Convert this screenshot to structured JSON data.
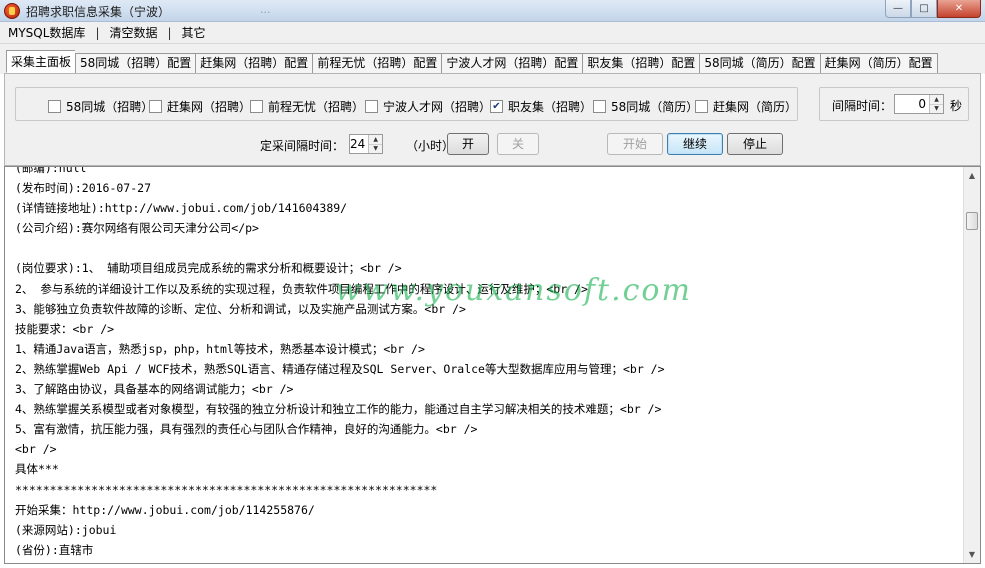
{
  "window": {
    "title": "招聘求职信息采集（宁波）",
    "title_ghost": "...",
    "controls": {
      "minimize": "—",
      "maximize": "□",
      "close": "✕"
    }
  },
  "menu": {
    "items": [
      "MYSQL数据库",
      "清空数据",
      "其它"
    ],
    "separator": "|"
  },
  "tabs": [
    "采集主面板",
    "58同城（招聘）配置",
    "赶集网（招聘）配置",
    "前程无忧（招聘）配置",
    "宁波人才网（招聘）配置",
    "职友集（招聘）配置",
    "58同城（简历）配置",
    "赶集网（简历）配置"
  ],
  "sources": [
    {
      "label": "58同城（招聘）",
      "checked": false
    },
    {
      "label": "赶集网（招聘）",
      "checked": false
    },
    {
      "label": "前程无忧（招聘）",
      "checked": false
    },
    {
      "label": "宁波人才网（招聘）",
      "checked": false
    },
    {
      "label": "职友集（招聘）",
      "checked": true
    },
    {
      "label": "58同城（简历）",
      "checked": false
    },
    {
      "label": "赶集网（简历）",
      "checked": false
    }
  ],
  "interval": {
    "label": "间隔时间：",
    "value": "0",
    "unit": "秒"
  },
  "schedule": {
    "label": "定采间隔时间：",
    "value": "24",
    "unit": "（小时）",
    "on_label": "开",
    "off_label": "关"
  },
  "actions": {
    "start": "开始",
    "continue": "继续",
    "stop": "停止"
  },
  "log": {
    "lines": [
      "(邮编):null",
      "(发布时间):2016-07-27",
      "(详情链接地址):http://www.jobui.com/job/141604389/",
      "(公司介绍):赛尔网络有限公司天津分公司</p>",
      "",
      "(岗位要求):1、 辅助项目组成员完成系统的需求分析和概要设计；<br />",
      "2、 参与系统的详细设计工作以及系统的实现过程，负责软件项目编程工作中的程序设计、运行及维护；<br />",
      "3、能够独立负责软件故障的诊断、定位、分析和调试，以及实施产品测试方案。<br />",
      "技能要求：<br />",
      "1、精通Java语言，熟悉jsp，php，html等技术，熟悉基本设计模式；<br />",
      "2、熟练掌握Web Api / WCF技术，熟悉SQL语言、精通存储过程及SQL Server、Oralce等大型数据库应用与管理；<br />",
      "3、了解路由协议，具备基本的网络调试能力；<br />",
      "4、熟练掌握关系模型或者对象模型，有较强的独立分析设计和独立工作的能力，能通过自主学习解决相关的技术难题；<br />",
      "5、富有激情，抗压能力强，具有强烈的责任心与团队合作精神，良好的沟通能力。<br />",
      "<br />",
      "具体***",
      "*************************************************************",
      "开始采集：http://www.jobui.com/job/114255876/",
      "(来源网站):jobui",
      "(省份):直辖市"
    ],
    "watermark": "www.youxansoft.com"
  }
}
